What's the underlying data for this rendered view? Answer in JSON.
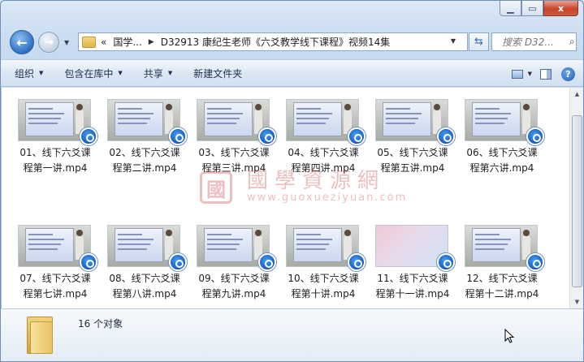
{
  "window": {
    "minimize_icon": "minimize-icon",
    "maximize_icon": "maximize-icon",
    "close_label": "x"
  },
  "address": {
    "overflow": "«",
    "crumbs": [
      "国学...",
      "D32913  康纪生老师《六爻教学线下课程》视频14集"
    ]
  },
  "search": {
    "placeholder": "搜索 D32..."
  },
  "toolbar": {
    "organize": "组织",
    "include_library": "包含在库中",
    "share": "共享",
    "new_folder": "新建文件夹"
  },
  "files": [
    {
      "line1": "01、线下六爻课",
      "line2": "程第一讲.mp4",
      "thumb": "video"
    },
    {
      "line1": "02、线下六爻课",
      "line2": "程第二讲.mp4",
      "thumb": "video"
    },
    {
      "line1": "03、线下六爻课",
      "line2": "程第三讲.mp4",
      "thumb": "video"
    },
    {
      "line1": "04、线下六爻课",
      "line2": "程第四讲.mp4",
      "thumb": "video"
    },
    {
      "line1": "05、线下六爻课",
      "line2": "程第五讲.mp4",
      "thumb": "video"
    },
    {
      "line1": "06、线下六爻课",
      "line2": "程第六讲.mp4",
      "thumb": "video"
    },
    {
      "line1": "07、线下六爻课",
      "line2": "程第七讲.mp4",
      "thumb": "video"
    },
    {
      "line1": "08、线下六爻课",
      "line2": "程第八讲.mp4",
      "thumb": "video"
    },
    {
      "line1": "09、线下六爻课",
      "line2": "程第九讲.mp4",
      "thumb": "video"
    },
    {
      "line1": "10、线下六爻课",
      "line2": "程第十讲.mp4",
      "thumb": "video"
    },
    {
      "line1": "11、线下六爻课",
      "line2": "程第十一讲.mp4",
      "thumb": "pink"
    },
    {
      "line1": "12、线下六爻课",
      "line2": "程第十二讲.mp4",
      "thumb": "video"
    }
  ],
  "details": {
    "count": "16 个对象"
  },
  "watermark": {
    "seal": "國",
    "title": "國學資源網",
    "url": "www.guoxueziyuan.com"
  }
}
